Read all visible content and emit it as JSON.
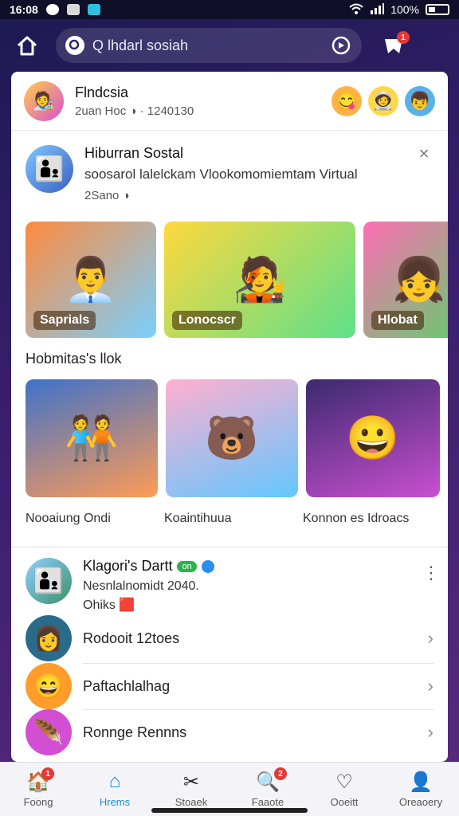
{
  "status_bar": {
    "time": "16:08",
    "battery": "100%"
  },
  "search": {
    "placeholder": "Q lhdarl sosiah"
  },
  "cart": {
    "badge": "1"
  },
  "profile": {
    "name": "Flndcsia",
    "subtitle": "2uan Hoc ◑ · 1240130",
    "avatar_emoji": "🧑‍🎨",
    "reaction_emojis": [
      "😋",
      "🧑‍🚀",
      "👦"
    ]
  },
  "post": {
    "avatar_emoji": "👨‍👦",
    "title": "Hiburran Sostal",
    "description": "soosarol lalelckam Vlookomomiemtam Virtual",
    "time": "2Sano ◑",
    "close": "×"
  },
  "top_tiles": [
    {
      "emoji": "👨‍💼",
      "label": "Saprials",
      "colors": [
        "#ff8a3d",
        "#7ad0ff"
      ]
    },
    {
      "emoji": "🧑‍🎤",
      "label": "Lonocscr",
      "colors": [
        "#ffd83d",
        "#5ee08a"
      ]
    },
    {
      "emoji": "👧",
      "label": "Hlobat",
      "colors": [
        "#ff6fb5",
        "#5bd16a"
      ]
    }
  ],
  "section_title": "Hobmitas's llok",
  "mid_tiles": [
    {
      "emoji": "🧑‍🤝‍🧑",
      "colors": [
        "#3f72c9",
        "#ff9b55"
      ]
    },
    {
      "emoji": "🐻",
      "colors": [
        "#ffb0d0",
        "#63c7ff"
      ]
    },
    {
      "emoji": "😀",
      "colors": [
        "#3b2a6e",
        "#c94fd1"
      ]
    }
  ],
  "captions": [
    "Nooaiung Ondi",
    "Koaintihuua",
    "Konnon es Idroacs"
  ],
  "friend": {
    "avatar_emoji": "👨‍👦",
    "name": "Klagori's Dartt",
    "online": "on",
    "sub1": "Nesnlalnomidt 2040.",
    "sub2": "Ohiks 🟥",
    "more": "⋮"
  },
  "list_items": [
    {
      "emoji": "👩",
      "label": "Rodooit 12toes",
      "bg": "#2a6b8a"
    },
    {
      "emoji": "😄",
      "label": "Paftachlalhag",
      "bg": "#ff9c2a"
    },
    {
      "emoji": "🪶",
      "label": "Ronnge Rennns",
      "bg": "#d24fd3"
    }
  ],
  "bottom_nav": [
    {
      "icon": "🏠",
      "label": "Foong",
      "badge": "1"
    },
    {
      "icon": "⌂",
      "label": "Hrems",
      "badge": ""
    },
    {
      "icon": "✂",
      "label": "Stoaek",
      "badge": ""
    },
    {
      "icon": "🔍",
      "label": "Faaote",
      "badge": "2"
    },
    {
      "icon": "♡",
      "label": "Ooeitt",
      "badge": ""
    },
    {
      "icon": "👤",
      "label": "Oreaoery",
      "badge": ""
    }
  ],
  "colors": {
    "accent": "#1a8fd0",
    "badge": "#e53935",
    "online": "#2bb34a"
  }
}
